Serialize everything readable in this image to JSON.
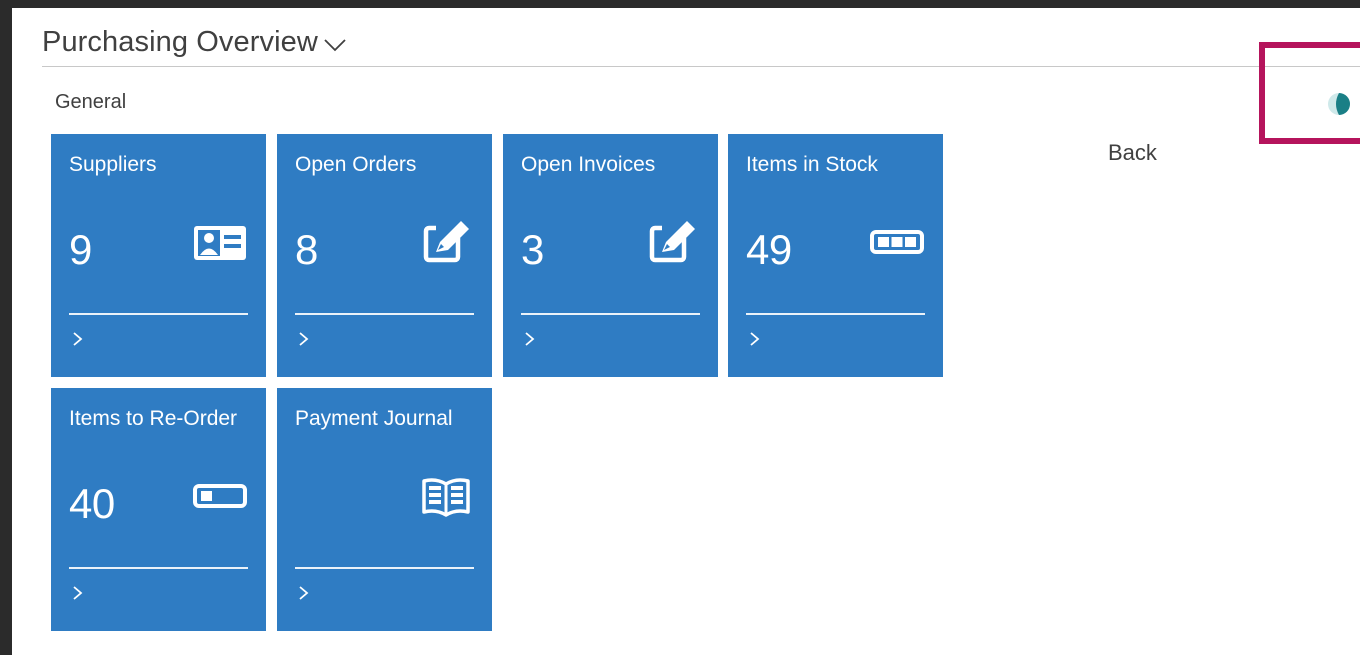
{
  "header": {
    "title": "Purchasing Overview",
    "chevron_icon": "chevron-down-icon"
  },
  "section": {
    "label": "General"
  },
  "tiles": [
    {
      "title": "Suppliers",
      "value": "9",
      "icon": "contact-card-icon"
    },
    {
      "title": "Open Orders",
      "value": "8",
      "icon": "edit-icon"
    },
    {
      "title": "Open Invoices",
      "value": "3",
      "icon": "edit-icon"
    },
    {
      "title": "Items in Stock",
      "value": "49",
      "icon": "battery-full-icon"
    },
    {
      "title": "Items to Re-Order",
      "value": "40",
      "icon": "battery-low-icon"
    },
    {
      "title": "Payment Journal",
      "value": "",
      "icon": "open-book-icon"
    }
  ],
  "side": {
    "back_label": "Back",
    "status_icon": "progress-half-icon"
  },
  "colors": {
    "tile_blue": "#2f7cc3",
    "highlight": "#b5145c",
    "status_teal": "#1a7f86"
  }
}
